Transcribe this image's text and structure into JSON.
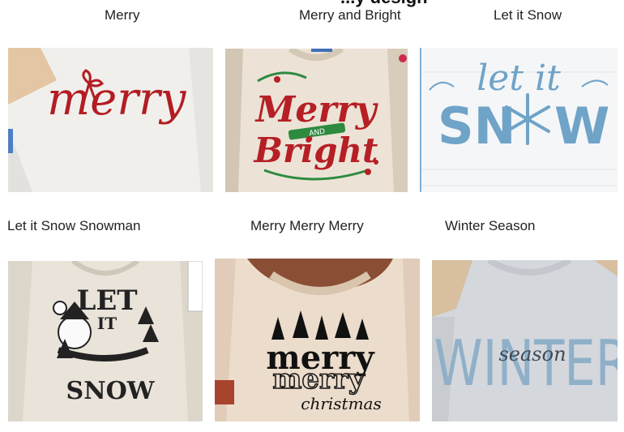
{
  "page": {
    "header_fragment": "...y design"
  },
  "designs": [
    {
      "title": "Merry",
      "art_text": "merry",
      "color": "#b31d22"
    },
    {
      "title": "Merry and Bright",
      "art_text_1": "Merry",
      "art_text_2": "AND",
      "art_text_3": "Bright",
      "color": "#b61f25"
    },
    {
      "title": "Let it Snow",
      "art_text_1": "let it",
      "art_text_2": "SN",
      "art_text_3": "W",
      "color": "#6fa3c8"
    },
    {
      "title": "Let it Snow Snowman",
      "art_text_1": "LET",
      "art_text_2": "IT",
      "art_text_3": "SNOW",
      "color": "#222222"
    },
    {
      "title": "Merry Merry Merry",
      "art_text_1": "merry",
      "art_text_2": "merry",
      "art_text_3": "christmas",
      "color": "#111111"
    },
    {
      "title": "Winter Season",
      "art_text_1": "WINTER",
      "art_text_2": "season",
      "color": "#8fb0c8"
    }
  ]
}
